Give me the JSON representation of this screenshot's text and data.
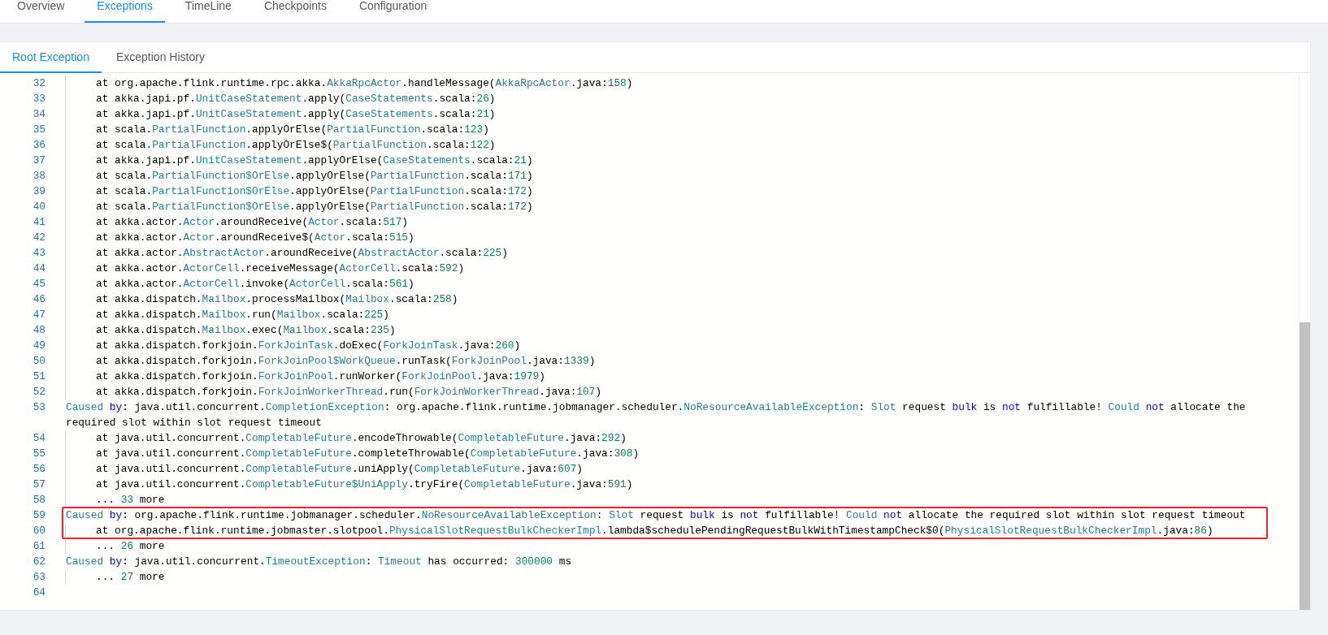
{
  "job_tabs": [
    {
      "label": "Overview",
      "selected": false
    },
    {
      "label": "Exceptions",
      "selected": true
    },
    {
      "label": "TimeLine",
      "selected": false
    },
    {
      "label": "Checkpoints",
      "selected": false
    },
    {
      "label": "Configuration",
      "selected": false
    }
  ],
  "exception_tabs": [
    {
      "label": "Root Exception",
      "selected": true
    },
    {
      "label": "Exception History",
      "selected": false
    }
  ],
  "code_lines": [
    {
      "number": "32",
      "indented": true,
      "boxed": false,
      "tokens": [
        {
          "text": "at org.apache.flink.runtime.rpc.akka.",
          "kind": "plain"
        },
        {
          "text": "AkkaRpcActor",
          "kind": "type"
        },
        {
          "text": ".handleMessage(",
          "kind": "plain"
        },
        {
          "text": "AkkaRpcActor",
          "kind": "type"
        },
        {
          "text": ".java:",
          "kind": "plain"
        },
        {
          "text": "158",
          "kind": "number"
        },
        {
          "text": ")",
          "kind": "plain"
        }
      ]
    },
    {
      "number": "33",
      "indented": true,
      "boxed": false,
      "tokens": [
        {
          "text": "at akka.japi.pf.",
          "kind": "plain"
        },
        {
          "text": "UnitCaseStatement",
          "kind": "type"
        },
        {
          "text": ".apply(",
          "kind": "plain"
        },
        {
          "text": "CaseStatements",
          "kind": "type"
        },
        {
          "text": ".scala:",
          "kind": "plain"
        },
        {
          "text": "26",
          "kind": "number"
        },
        {
          "text": ")",
          "kind": "plain"
        }
      ]
    },
    {
      "number": "34",
      "indented": true,
      "boxed": false,
      "tokens": [
        {
          "text": "at akka.japi.pf.",
          "kind": "plain"
        },
        {
          "text": "UnitCaseStatement",
          "kind": "type"
        },
        {
          "text": ".apply(",
          "kind": "plain"
        },
        {
          "text": "CaseStatements",
          "kind": "type"
        },
        {
          "text": ".scala:",
          "kind": "plain"
        },
        {
          "text": "21",
          "kind": "number"
        },
        {
          "text": ")",
          "kind": "plain"
        }
      ]
    },
    {
      "number": "35",
      "indented": true,
      "boxed": false,
      "tokens": [
        {
          "text": "at scala.",
          "kind": "plain"
        },
        {
          "text": "PartialFunction",
          "kind": "type"
        },
        {
          "text": ".applyOrElse(",
          "kind": "plain"
        },
        {
          "text": "PartialFunction",
          "kind": "type"
        },
        {
          "text": ".scala:",
          "kind": "plain"
        },
        {
          "text": "123",
          "kind": "number"
        },
        {
          "text": ")",
          "kind": "plain"
        }
      ]
    },
    {
      "number": "36",
      "indented": true,
      "boxed": false,
      "tokens": [
        {
          "text": "at scala.",
          "kind": "plain"
        },
        {
          "text": "PartialFunction",
          "kind": "type"
        },
        {
          "text": ".applyOrElse$(",
          "kind": "plain"
        },
        {
          "text": "PartialFunction",
          "kind": "type"
        },
        {
          "text": ".scala:",
          "kind": "plain"
        },
        {
          "text": "122",
          "kind": "number"
        },
        {
          "text": ")",
          "kind": "plain"
        }
      ]
    },
    {
      "number": "37",
      "indented": true,
      "boxed": false,
      "tokens": [
        {
          "text": "at akka.japi.pf.",
          "kind": "plain"
        },
        {
          "text": "UnitCaseStatement",
          "kind": "type"
        },
        {
          "text": ".applyOrElse(",
          "kind": "plain"
        },
        {
          "text": "CaseStatements",
          "kind": "type"
        },
        {
          "text": ".scala:",
          "kind": "plain"
        },
        {
          "text": "21",
          "kind": "number"
        },
        {
          "text": ")",
          "kind": "plain"
        }
      ]
    },
    {
      "number": "38",
      "indented": true,
      "boxed": false,
      "tokens": [
        {
          "text": "at scala.",
          "kind": "plain"
        },
        {
          "text": "PartialFunction$OrElse",
          "kind": "type"
        },
        {
          "text": ".applyOrElse(",
          "kind": "plain"
        },
        {
          "text": "PartialFunction",
          "kind": "type"
        },
        {
          "text": ".scala:",
          "kind": "plain"
        },
        {
          "text": "171",
          "kind": "number"
        },
        {
          "text": ")",
          "kind": "plain"
        }
      ]
    },
    {
      "number": "39",
      "indented": true,
      "boxed": false,
      "tokens": [
        {
          "text": "at scala.",
          "kind": "plain"
        },
        {
          "text": "PartialFunction$OrElse",
          "kind": "type"
        },
        {
          "text": ".applyOrElse(",
          "kind": "plain"
        },
        {
          "text": "PartialFunction",
          "kind": "type"
        },
        {
          "text": ".scala:",
          "kind": "plain"
        },
        {
          "text": "172",
          "kind": "number"
        },
        {
          "text": ")",
          "kind": "plain"
        }
      ]
    },
    {
      "number": "40",
      "indented": true,
      "boxed": false,
      "tokens": [
        {
          "text": "at scala.",
          "kind": "plain"
        },
        {
          "text": "PartialFunction$OrElse",
          "kind": "type"
        },
        {
          "text": ".applyOrElse(",
          "kind": "plain"
        },
        {
          "text": "PartialFunction",
          "kind": "type"
        },
        {
          "text": ".scala:",
          "kind": "plain"
        },
        {
          "text": "172",
          "kind": "number"
        },
        {
          "text": ")",
          "kind": "plain"
        }
      ]
    },
    {
      "number": "41",
      "indented": true,
      "boxed": false,
      "tokens": [
        {
          "text": "at akka.actor.",
          "kind": "plain"
        },
        {
          "text": "Actor",
          "kind": "type"
        },
        {
          "text": ".aroundReceive(",
          "kind": "plain"
        },
        {
          "text": "Actor",
          "kind": "type"
        },
        {
          "text": ".scala:",
          "kind": "plain"
        },
        {
          "text": "517",
          "kind": "number"
        },
        {
          "text": ")",
          "kind": "plain"
        }
      ]
    },
    {
      "number": "42",
      "indented": true,
      "boxed": false,
      "tokens": [
        {
          "text": "at akka.actor.",
          "kind": "plain"
        },
        {
          "text": "Actor",
          "kind": "type"
        },
        {
          "text": ".aroundReceive$(",
          "kind": "plain"
        },
        {
          "text": "Actor",
          "kind": "type"
        },
        {
          "text": ".scala:",
          "kind": "plain"
        },
        {
          "text": "515",
          "kind": "number"
        },
        {
          "text": ")",
          "kind": "plain"
        }
      ]
    },
    {
      "number": "43",
      "indented": true,
      "boxed": false,
      "tokens": [
        {
          "text": "at akka.actor.",
          "kind": "plain"
        },
        {
          "text": "AbstractActor",
          "kind": "type"
        },
        {
          "text": ".aroundReceive(",
          "kind": "plain"
        },
        {
          "text": "AbstractActor",
          "kind": "type"
        },
        {
          "text": ".scala:",
          "kind": "plain"
        },
        {
          "text": "225",
          "kind": "number"
        },
        {
          "text": ")",
          "kind": "plain"
        }
      ]
    },
    {
      "number": "44",
      "indented": true,
      "boxed": false,
      "tokens": [
        {
          "text": "at akka.actor.",
          "kind": "plain"
        },
        {
          "text": "ActorCell",
          "kind": "type"
        },
        {
          "text": ".receiveMessage(",
          "kind": "plain"
        },
        {
          "text": "ActorCell",
          "kind": "type"
        },
        {
          "text": ".scala:",
          "kind": "plain"
        },
        {
          "text": "592",
          "kind": "number"
        },
        {
          "text": ")",
          "kind": "plain"
        }
      ]
    },
    {
      "number": "45",
      "indented": true,
      "boxed": false,
      "tokens": [
        {
          "text": "at akka.actor.",
          "kind": "plain"
        },
        {
          "text": "ActorCell",
          "kind": "type"
        },
        {
          "text": ".invoke(",
          "kind": "plain"
        },
        {
          "text": "ActorCell",
          "kind": "type"
        },
        {
          "text": ".scala:",
          "kind": "plain"
        },
        {
          "text": "561",
          "kind": "number"
        },
        {
          "text": ")",
          "kind": "plain"
        }
      ]
    },
    {
      "number": "46",
      "indented": true,
      "boxed": false,
      "tokens": [
        {
          "text": "at akka.dispatch.",
          "kind": "plain"
        },
        {
          "text": "Mailbox",
          "kind": "type"
        },
        {
          "text": ".processMailbox(",
          "kind": "plain"
        },
        {
          "text": "Mailbox",
          "kind": "type"
        },
        {
          "text": ".scala:",
          "kind": "plain"
        },
        {
          "text": "258",
          "kind": "number"
        },
        {
          "text": ")",
          "kind": "plain"
        }
      ]
    },
    {
      "number": "47",
      "indented": true,
      "boxed": false,
      "tokens": [
        {
          "text": "at akka.dispatch.",
          "kind": "plain"
        },
        {
          "text": "Mailbox",
          "kind": "type"
        },
        {
          "text": ".run(",
          "kind": "plain"
        },
        {
          "text": "Mailbox",
          "kind": "type"
        },
        {
          "text": ".scala:",
          "kind": "plain"
        },
        {
          "text": "225",
          "kind": "number"
        },
        {
          "text": ")",
          "kind": "plain"
        }
      ]
    },
    {
      "number": "48",
      "indented": true,
      "boxed": false,
      "tokens": [
        {
          "text": "at akka.dispatch.",
          "kind": "plain"
        },
        {
          "text": "Mailbox",
          "kind": "type"
        },
        {
          "text": ".exec(",
          "kind": "plain"
        },
        {
          "text": "Mailbox",
          "kind": "type"
        },
        {
          "text": ".scala:",
          "kind": "plain"
        },
        {
          "text": "235",
          "kind": "number"
        },
        {
          "text": ")",
          "kind": "plain"
        }
      ]
    },
    {
      "number": "49",
      "indented": true,
      "boxed": false,
      "tokens": [
        {
          "text": "at akka.dispatch.forkjoin.",
          "kind": "plain"
        },
        {
          "text": "ForkJoinTask",
          "kind": "type"
        },
        {
          "text": ".doExec(",
          "kind": "plain"
        },
        {
          "text": "ForkJoinTask",
          "kind": "type"
        },
        {
          "text": ".java:",
          "kind": "plain"
        },
        {
          "text": "260",
          "kind": "number"
        },
        {
          "text": ")",
          "kind": "plain"
        }
      ]
    },
    {
      "number": "50",
      "indented": true,
      "boxed": false,
      "tokens": [
        {
          "text": "at akka.dispatch.forkjoin.",
          "kind": "plain"
        },
        {
          "text": "ForkJoinPool$WorkQueue",
          "kind": "type"
        },
        {
          "text": ".runTask(",
          "kind": "plain"
        },
        {
          "text": "ForkJoinPool",
          "kind": "type"
        },
        {
          "text": ".java:",
          "kind": "plain"
        },
        {
          "text": "1339",
          "kind": "number"
        },
        {
          "text": ")",
          "kind": "plain"
        }
      ]
    },
    {
      "number": "51",
      "indented": true,
      "boxed": false,
      "tokens": [
        {
          "text": "at akka.dispatch.forkjoin.",
          "kind": "plain"
        },
        {
          "text": "ForkJoinPool",
          "kind": "type"
        },
        {
          "text": ".runWorker(",
          "kind": "plain"
        },
        {
          "text": "ForkJoinPool",
          "kind": "type"
        },
        {
          "text": ".java:",
          "kind": "plain"
        },
        {
          "text": "1979",
          "kind": "number"
        },
        {
          "text": ")",
          "kind": "plain"
        }
      ]
    },
    {
      "number": "52",
      "indented": true,
      "boxed": false,
      "tokens": [
        {
          "text": "at akka.dispatch.forkjoin.",
          "kind": "plain"
        },
        {
          "text": "ForkJoinWorkerThread",
          "kind": "type"
        },
        {
          "text": ".run(",
          "kind": "plain"
        },
        {
          "text": "ForkJoinWorkerThread",
          "kind": "type"
        },
        {
          "text": ".java:",
          "kind": "plain"
        },
        {
          "text": "107",
          "kind": "number"
        },
        {
          "text": ")",
          "kind": "plain"
        }
      ]
    },
    {
      "number": "53",
      "indented": false,
      "boxed": false,
      "tokens": [
        {
          "text": "Caused ",
          "kind": "type"
        },
        {
          "text": "by",
          "kind": "keyword"
        },
        {
          "text": ": java.util.concurrent.",
          "kind": "plain"
        },
        {
          "text": "CompletionException",
          "kind": "type"
        },
        {
          "text": ": org.apache.flink.runtime.jobmanager.scheduler.",
          "kind": "plain"
        },
        {
          "text": "NoResourceAvailableException",
          "kind": "type"
        },
        {
          "text": ": ",
          "kind": "plain"
        },
        {
          "text": "Slot",
          "kind": "type"
        },
        {
          "text": " request ",
          "kind": "plain"
        },
        {
          "text": "bulk",
          "kind": "keyword"
        },
        {
          "text": " is ",
          "kind": "plain"
        },
        {
          "text": "not",
          "kind": "keyword"
        },
        {
          "text": " fulfillable! ",
          "kind": "plain"
        },
        {
          "text": "Could ",
          "kind": "type"
        },
        {
          "text": "not",
          "kind": "keyword"
        },
        {
          "text": " allocate the required slot within slot request timeout",
          "kind": "plain"
        }
      ]
    },
    {
      "number": "54",
      "indented": true,
      "boxed": false,
      "tokens": [
        {
          "text": "at java.util.concurrent.",
          "kind": "plain"
        },
        {
          "text": "CompletableFuture",
          "kind": "type"
        },
        {
          "text": ".encodeThrowable(",
          "kind": "plain"
        },
        {
          "text": "CompletableFuture",
          "kind": "type"
        },
        {
          "text": ".java:",
          "kind": "plain"
        },
        {
          "text": "292",
          "kind": "number"
        },
        {
          "text": ")",
          "kind": "plain"
        }
      ]
    },
    {
      "number": "55",
      "indented": true,
      "boxed": false,
      "tokens": [
        {
          "text": "at java.util.concurrent.",
          "kind": "plain"
        },
        {
          "text": "CompletableFuture",
          "kind": "type"
        },
        {
          "text": ".completeThrowable(",
          "kind": "plain"
        },
        {
          "text": "CompletableFuture",
          "kind": "type"
        },
        {
          "text": ".java:",
          "kind": "plain"
        },
        {
          "text": "308",
          "kind": "number"
        },
        {
          "text": ")",
          "kind": "plain"
        }
      ]
    },
    {
      "number": "56",
      "indented": true,
      "boxed": false,
      "tokens": [
        {
          "text": "at java.util.concurrent.",
          "kind": "plain"
        },
        {
          "text": "CompletableFuture",
          "kind": "type"
        },
        {
          "text": ".uniApply(",
          "kind": "plain"
        },
        {
          "text": "CompletableFuture",
          "kind": "type"
        },
        {
          "text": ".java:",
          "kind": "plain"
        },
        {
          "text": "607",
          "kind": "number"
        },
        {
          "text": ")",
          "kind": "plain"
        }
      ]
    },
    {
      "number": "57",
      "indented": true,
      "boxed": false,
      "tokens": [
        {
          "text": "at java.util.concurrent.",
          "kind": "plain"
        },
        {
          "text": "CompletableFuture$UniApply",
          "kind": "type"
        },
        {
          "text": ".tryFire(",
          "kind": "plain"
        },
        {
          "text": "CompletableFuture",
          "kind": "type"
        },
        {
          "text": ".java:",
          "kind": "plain"
        },
        {
          "text": "591",
          "kind": "number"
        },
        {
          "text": ")",
          "kind": "plain"
        }
      ]
    },
    {
      "number": "58",
      "indented": true,
      "boxed": false,
      "tokens": [
        {
          "text": "... ",
          "kind": "plain"
        },
        {
          "text": "33",
          "kind": "number"
        },
        {
          "text": " more",
          "kind": "plain"
        }
      ]
    },
    {
      "number": "59",
      "indented": false,
      "boxed": true,
      "tokens": [
        {
          "text": "Caused ",
          "kind": "type"
        },
        {
          "text": "by",
          "kind": "keyword"
        },
        {
          "text": ": org.apache.flink.runtime.jobmanager.scheduler.",
          "kind": "plain"
        },
        {
          "text": "NoResourceAvailableException",
          "kind": "type"
        },
        {
          "text": ": ",
          "kind": "plain"
        },
        {
          "text": "Slot",
          "kind": "type"
        },
        {
          "text": " request ",
          "kind": "plain"
        },
        {
          "text": "bulk",
          "kind": "keyword"
        },
        {
          "text": " is ",
          "kind": "plain"
        },
        {
          "text": "not",
          "kind": "keyword"
        },
        {
          "text": " fulfillable! ",
          "kind": "plain"
        },
        {
          "text": "Could ",
          "kind": "type"
        },
        {
          "text": "not",
          "kind": "keyword"
        },
        {
          "text": " allocate the required slot within slot request timeout",
          "kind": "plain"
        }
      ]
    },
    {
      "number": "60",
      "indented": true,
      "boxed": true,
      "tokens": [
        {
          "text": "at org.apache.flink.runtime.jobmaster.slotpool.",
          "kind": "plain"
        },
        {
          "text": "PhysicalSlotRequestBulkCheckerImpl",
          "kind": "type"
        },
        {
          "text": ".lambda$schedulePendingRequestBulkWithTimestampCheck$0(",
          "kind": "plain"
        },
        {
          "text": "PhysicalSlotRequestBulkCheckerImpl",
          "kind": "type"
        },
        {
          "text": ".java:",
          "kind": "plain"
        },
        {
          "text": "86",
          "kind": "number"
        },
        {
          "text": ")",
          "kind": "plain"
        }
      ]
    },
    {
      "number": "61",
      "indented": true,
      "boxed": false,
      "tokens": [
        {
          "text": "... ",
          "kind": "plain"
        },
        {
          "text": "26",
          "kind": "number"
        },
        {
          "text": " more",
          "kind": "plain"
        }
      ]
    },
    {
      "number": "62",
      "indented": false,
      "boxed": false,
      "tokens": [
        {
          "text": "Caused ",
          "kind": "type"
        },
        {
          "text": "by",
          "kind": "keyword"
        },
        {
          "text": ": java.util.concurrent.",
          "kind": "plain"
        },
        {
          "text": "TimeoutException",
          "kind": "type"
        },
        {
          "text": ": ",
          "kind": "plain"
        },
        {
          "text": "Timeout",
          "kind": "type"
        },
        {
          "text": " has occurred: ",
          "kind": "plain"
        },
        {
          "text": "300000",
          "kind": "number"
        },
        {
          "text": " ms",
          "kind": "plain"
        }
      ]
    },
    {
      "number": "63",
      "indented": true,
      "boxed": false,
      "tokens": [
        {
          "text": "... ",
          "kind": "plain"
        },
        {
          "text": "27",
          "kind": "number"
        },
        {
          "text": " more",
          "kind": "plain"
        }
      ]
    },
    {
      "number": "64",
      "indented": false,
      "boxed": false
    }
  ]
}
